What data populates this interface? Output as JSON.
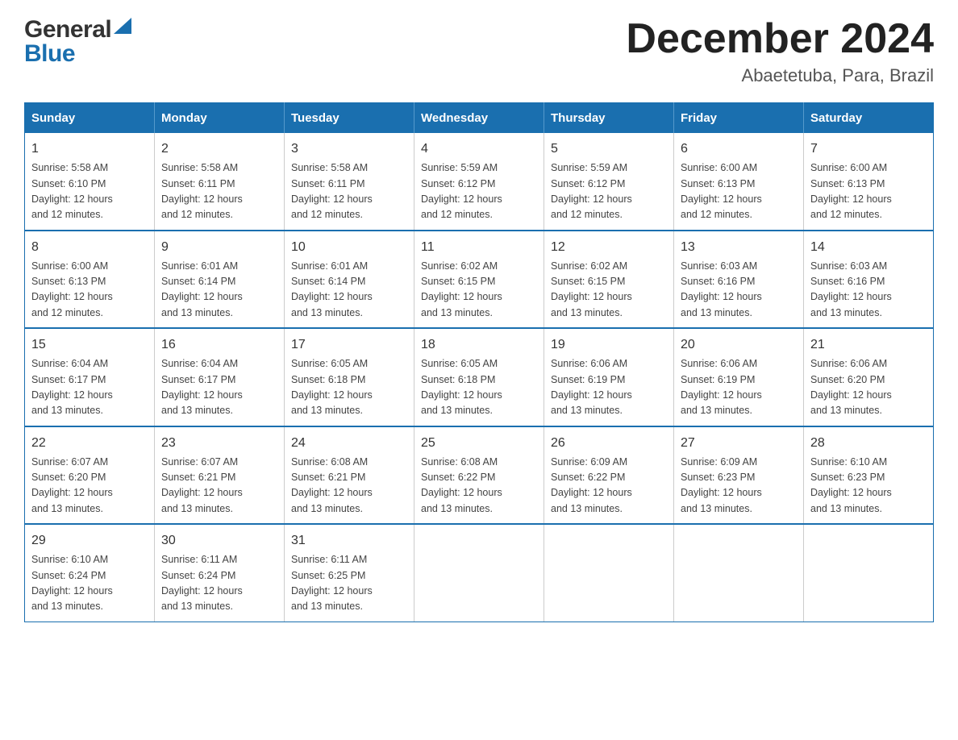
{
  "header": {
    "logo_general": "General",
    "logo_blue": "Blue",
    "main_title": "December 2024",
    "subtitle": "Abaetetuba, Para, Brazil"
  },
  "columns": [
    "Sunday",
    "Monday",
    "Tuesday",
    "Wednesday",
    "Thursday",
    "Friday",
    "Saturday"
  ],
  "weeks": [
    [
      {
        "day": "1",
        "sunrise": "5:58 AM",
        "sunset": "6:10 PM",
        "daylight": "12 hours and 12 minutes."
      },
      {
        "day": "2",
        "sunrise": "5:58 AM",
        "sunset": "6:11 PM",
        "daylight": "12 hours and 12 minutes."
      },
      {
        "day": "3",
        "sunrise": "5:58 AM",
        "sunset": "6:11 PM",
        "daylight": "12 hours and 12 minutes."
      },
      {
        "day": "4",
        "sunrise": "5:59 AM",
        "sunset": "6:12 PM",
        "daylight": "12 hours and 12 minutes."
      },
      {
        "day": "5",
        "sunrise": "5:59 AM",
        "sunset": "6:12 PM",
        "daylight": "12 hours and 12 minutes."
      },
      {
        "day": "6",
        "sunrise": "6:00 AM",
        "sunset": "6:13 PM",
        "daylight": "12 hours and 12 minutes."
      },
      {
        "day": "7",
        "sunrise": "6:00 AM",
        "sunset": "6:13 PM",
        "daylight": "12 hours and 12 minutes."
      }
    ],
    [
      {
        "day": "8",
        "sunrise": "6:00 AM",
        "sunset": "6:13 PM",
        "daylight": "12 hours and 12 minutes."
      },
      {
        "day": "9",
        "sunrise": "6:01 AM",
        "sunset": "6:14 PM",
        "daylight": "12 hours and 13 minutes."
      },
      {
        "day": "10",
        "sunrise": "6:01 AM",
        "sunset": "6:14 PM",
        "daylight": "12 hours and 13 minutes."
      },
      {
        "day": "11",
        "sunrise": "6:02 AM",
        "sunset": "6:15 PM",
        "daylight": "12 hours and 13 minutes."
      },
      {
        "day": "12",
        "sunrise": "6:02 AM",
        "sunset": "6:15 PM",
        "daylight": "12 hours and 13 minutes."
      },
      {
        "day": "13",
        "sunrise": "6:03 AM",
        "sunset": "6:16 PM",
        "daylight": "12 hours and 13 minutes."
      },
      {
        "day": "14",
        "sunrise": "6:03 AM",
        "sunset": "6:16 PM",
        "daylight": "12 hours and 13 minutes."
      }
    ],
    [
      {
        "day": "15",
        "sunrise": "6:04 AM",
        "sunset": "6:17 PM",
        "daylight": "12 hours and 13 minutes."
      },
      {
        "day": "16",
        "sunrise": "6:04 AM",
        "sunset": "6:17 PM",
        "daylight": "12 hours and 13 minutes."
      },
      {
        "day": "17",
        "sunrise": "6:05 AM",
        "sunset": "6:18 PM",
        "daylight": "12 hours and 13 minutes."
      },
      {
        "day": "18",
        "sunrise": "6:05 AM",
        "sunset": "6:18 PM",
        "daylight": "12 hours and 13 minutes."
      },
      {
        "day": "19",
        "sunrise": "6:06 AM",
        "sunset": "6:19 PM",
        "daylight": "12 hours and 13 minutes."
      },
      {
        "day": "20",
        "sunrise": "6:06 AM",
        "sunset": "6:19 PM",
        "daylight": "12 hours and 13 minutes."
      },
      {
        "day": "21",
        "sunrise": "6:06 AM",
        "sunset": "6:20 PM",
        "daylight": "12 hours and 13 minutes."
      }
    ],
    [
      {
        "day": "22",
        "sunrise": "6:07 AM",
        "sunset": "6:20 PM",
        "daylight": "12 hours and 13 minutes."
      },
      {
        "day": "23",
        "sunrise": "6:07 AM",
        "sunset": "6:21 PM",
        "daylight": "12 hours and 13 minutes."
      },
      {
        "day": "24",
        "sunrise": "6:08 AM",
        "sunset": "6:21 PM",
        "daylight": "12 hours and 13 minutes."
      },
      {
        "day": "25",
        "sunrise": "6:08 AM",
        "sunset": "6:22 PM",
        "daylight": "12 hours and 13 minutes."
      },
      {
        "day": "26",
        "sunrise": "6:09 AM",
        "sunset": "6:22 PM",
        "daylight": "12 hours and 13 minutes."
      },
      {
        "day": "27",
        "sunrise": "6:09 AM",
        "sunset": "6:23 PM",
        "daylight": "12 hours and 13 minutes."
      },
      {
        "day": "28",
        "sunrise": "6:10 AM",
        "sunset": "6:23 PM",
        "daylight": "12 hours and 13 minutes."
      }
    ],
    [
      {
        "day": "29",
        "sunrise": "6:10 AM",
        "sunset": "6:24 PM",
        "daylight": "12 hours and 13 minutes."
      },
      {
        "day": "30",
        "sunrise": "6:11 AM",
        "sunset": "6:24 PM",
        "daylight": "12 hours and 13 minutes."
      },
      {
        "day": "31",
        "sunrise": "6:11 AM",
        "sunset": "6:25 PM",
        "daylight": "12 hours and 13 minutes."
      },
      null,
      null,
      null,
      null
    ]
  ],
  "labels": {
    "sunrise_prefix": "Sunrise: ",
    "sunset_prefix": "Sunset: ",
    "daylight_prefix": "Daylight: "
  }
}
